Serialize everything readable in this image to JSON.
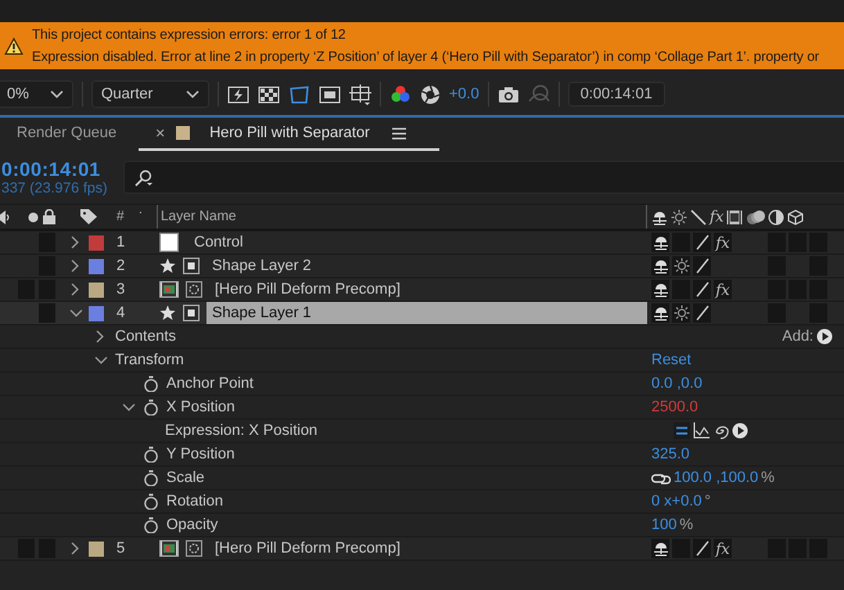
{
  "banner": {
    "title": "This project contains expression errors: error 1 of 12",
    "message": "Expression disabled. Error at line 2 in property ‘Z Position’ of layer 4 (‘Hero Pill with Separator’) in comp ‘Collage Part 1’.  property or"
  },
  "viewer_toolbar": {
    "zoom": "0%",
    "resolution": "Quarter",
    "exposure": "+0.0",
    "timecode": "0:00:14:01"
  },
  "tabs": [
    {
      "label": "Render Queue",
      "selected": false
    },
    {
      "label": "Hero Pill with Separator",
      "selected": true,
      "close": "×",
      "color": "#c8b28a"
    }
  ],
  "timeline": {
    "timecode": "0:00:14:01",
    "frame_info": "337 (23.976 fps)",
    "columns": {
      "number": "#",
      "dot": ".",
      "layer_name": "Layer Name",
      "effects": "fx"
    }
  },
  "layers": [
    {
      "number": "1",
      "name": "Control",
      "kind": "solid",
      "color": "#c23b3b",
      "expanded": false,
      "selected": false,
      "effects": true,
      "effects_label": "fx"
    },
    {
      "number": "2",
      "name": "Shape Layer 2",
      "kind": "shape",
      "color": "#6b7fe0",
      "expanded": false,
      "selected": false,
      "effects": false
    },
    {
      "number": "3",
      "name": "[Hero Pill Deform Precomp]",
      "kind": "precomp",
      "color": "#b9a882",
      "expanded": false,
      "selected": false,
      "effects": true,
      "effects_label": "fx"
    },
    {
      "number": "4",
      "name": "Shape Layer 1",
      "kind": "shape",
      "color": "#6b7fe0",
      "expanded": true,
      "selected": true,
      "effects": false,
      "properties": [
        {
          "kind": "group",
          "name": "Contents",
          "expanded": false,
          "add_label": "Add:"
        },
        {
          "kind": "group",
          "name": "Transform",
          "expanded": true,
          "value": "Reset",
          "children": [
            {
              "kind": "property",
              "name": "Anchor Point",
              "value": "0.0 ,0.0",
              "error": false
            },
            {
              "kind": "property",
              "name": "X Position",
              "value": "2500.0",
              "error": true,
              "expanded": true,
              "children": [
                {
                  "kind": "expression",
                  "name": "Expression: X Position"
                }
              ]
            },
            {
              "kind": "property",
              "name": "Y Position",
              "value": "325.0",
              "error": false
            },
            {
              "kind": "property",
              "name": "Scale",
              "value": "100.0 ,100.0",
              "unit": "%",
              "linked": true,
              "error": false
            },
            {
              "kind": "property",
              "name": "Rotation",
              "value": "0 x+0.0",
              "unit": "°",
              "error": false
            },
            {
              "kind": "property",
              "name": "Opacity",
              "value": "100",
              "unit": "%",
              "error": false
            }
          ]
        }
      ]
    },
    {
      "number": "5",
      "name": "[Hero Pill Deform Precomp]",
      "kind": "precomp",
      "color": "#b9a882",
      "expanded": false,
      "selected": false,
      "effects": true,
      "effects_label": "fx"
    }
  ]
}
